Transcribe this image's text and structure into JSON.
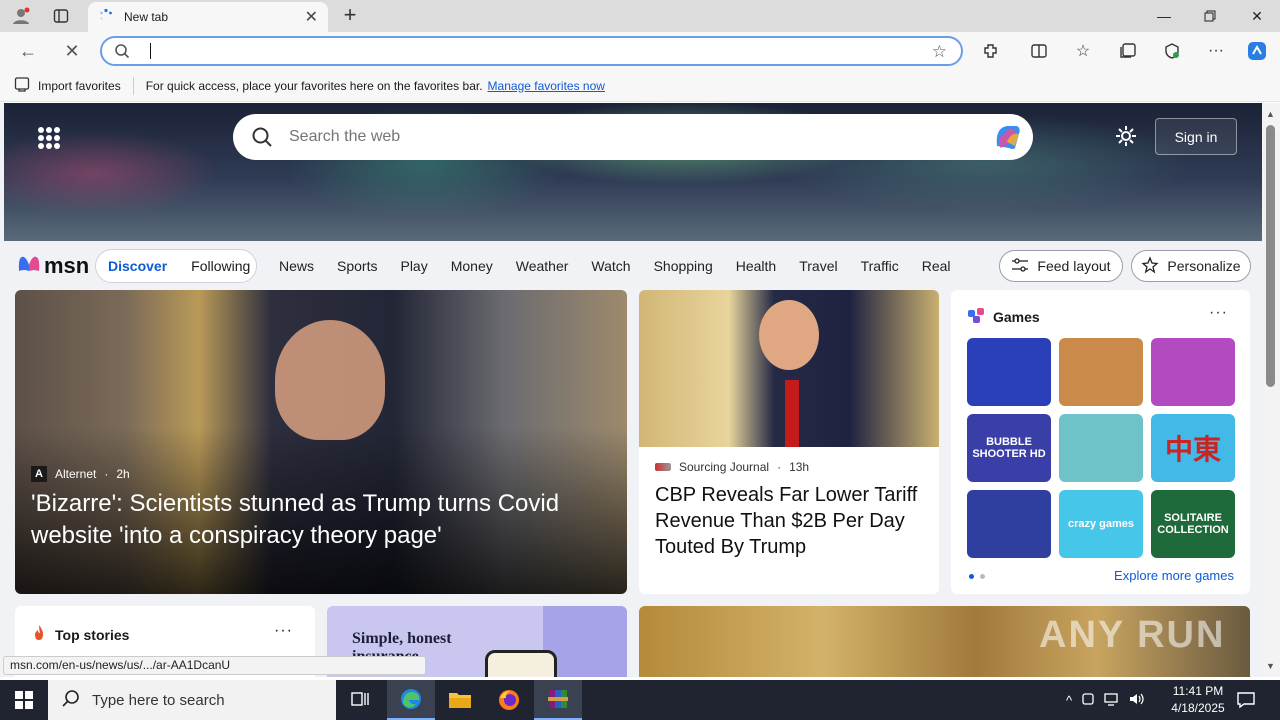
{
  "browser": {
    "tab_title": "New tab",
    "address_value": "",
    "favorites_bar": {
      "import_label": "Import favorites",
      "hint_text": "For quick access, place your favorites here on the favorites bar.",
      "manage_link": "Manage favorites now"
    },
    "status_url": "msn.com/en-us/news/us/.../ar-AA1DcanU"
  },
  "hero": {
    "search_placeholder": "Search the web",
    "signin_label": "Sign in"
  },
  "msn": {
    "logo_text": "msn",
    "tabs": [
      {
        "label": "Discover"
      },
      {
        "label": "Following"
      }
    ],
    "categories": [
      "News",
      "Sports",
      "Play",
      "Money",
      "Weather",
      "Watch",
      "Shopping",
      "Health",
      "Travel",
      "Traffic",
      "Real E"
    ],
    "feed_layout_label": "Feed layout",
    "personalize_label": "Personalize"
  },
  "cards": {
    "main": {
      "source": "Alternet",
      "badge": "A",
      "age": "2h",
      "headline": "'Bizarre': Scientists stunned as Trump turns Covid website 'into a conspiracy theory page'"
    },
    "second": {
      "source": "Sourcing Journal",
      "age": "13h",
      "headline": "CBP Reveals Far Lower Tariff Revenue Than $2B Per Day Touted By Trump"
    },
    "games": {
      "title": "Games",
      "explore_label": "Explore more games",
      "tiles": [
        {
          "name": "jewel-game",
          "label": "",
          "color": "#2a3fb8"
        },
        {
          "name": "wood-screw-game",
          "label": "",
          "color": "#c98a4a"
        },
        {
          "name": "makeup-game",
          "label": "",
          "color": "#b24ac0"
        },
        {
          "name": "bubble-shooter-game",
          "label": "BUBBLE SHOOTER HD",
          "color": "#3a3fa8"
        },
        {
          "name": "hospital-game",
          "label": "",
          "color": "#6fc3c8"
        },
        {
          "name": "mahjong-game",
          "label": "中東",
          "color": "#43b9e8"
        },
        {
          "name": "block-puzzle-game",
          "label": "",
          "color": "#2f3fa0"
        },
        {
          "name": "crazy-games-game",
          "label": "crazy games",
          "color": "#46c6e8"
        },
        {
          "name": "solitaire-game",
          "label": "SOLITAIRE COLLECTION",
          "color": "#1f6a3a"
        }
      ]
    },
    "top_stories": {
      "title": "Top stories"
    },
    "ad": {
      "title": "Simple, honest insurance"
    },
    "watermark": "ANY RUN"
  },
  "taskbar": {
    "search_placeholder": "Type here to search",
    "time": "11:41 PM",
    "date": "4/18/2025"
  }
}
